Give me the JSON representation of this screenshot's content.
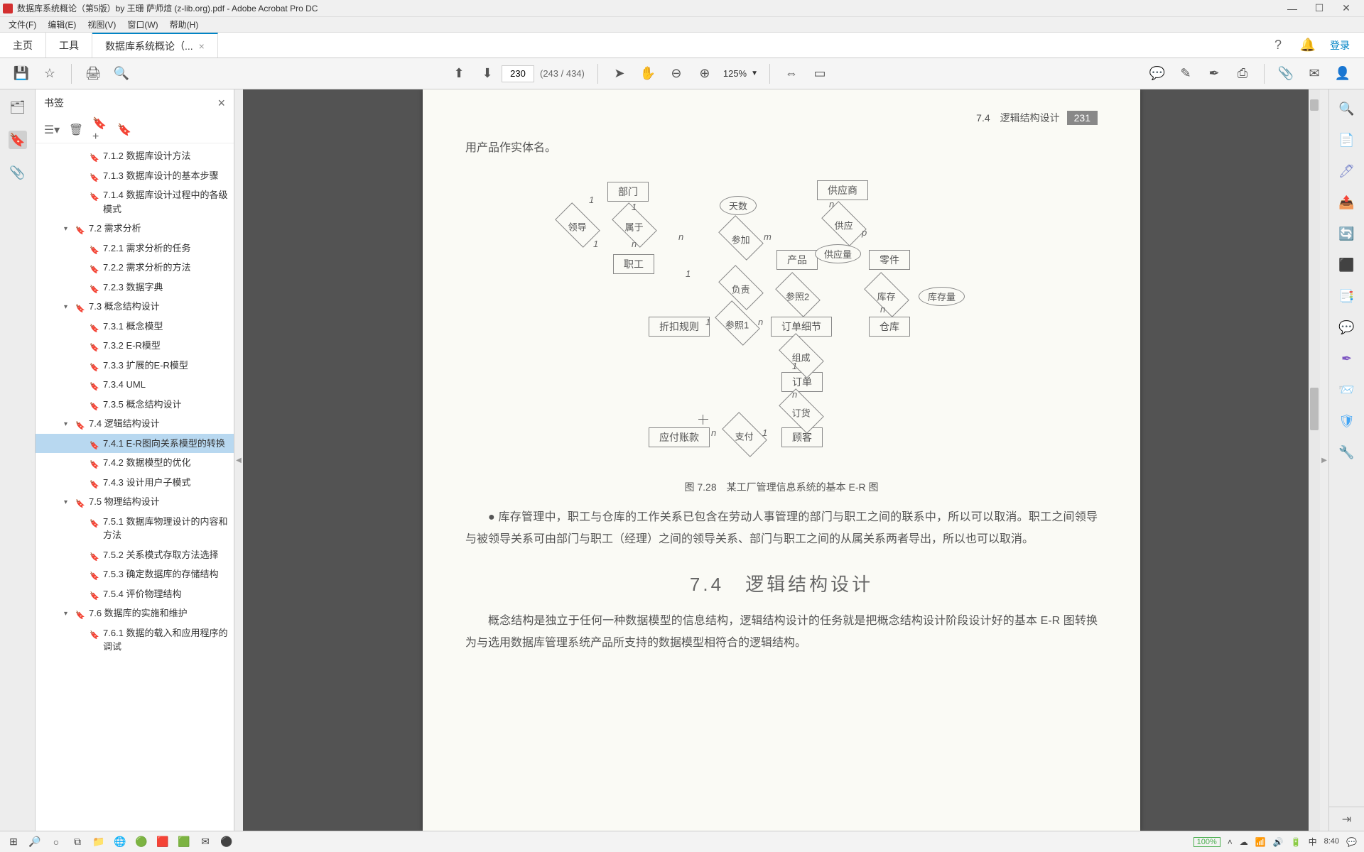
{
  "titlebar": {
    "title": "数据库系统概论（第5版）by 王珊 萨师煊 (z-lib.org).pdf - Adobe Acrobat Pro DC"
  },
  "menubar": {
    "items": [
      "文件(F)",
      "编辑(E)",
      "视图(V)",
      "窗口(W)",
      "帮助(H)"
    ]
  },
  "tabs": {
    "home": "主页",
    "tools": "工具",
    "doc": "数据库系统概论（..."
  },
  "tab_right": {
    "login": "登录"
  },
  "toolbar": {
    "page_value": "230",
    "page_total": "(243 / 434)",
    "zoom": "125%"
  },
  "bookmarks": {
    "title": "书签",
    "items": [
      {
        "lvl": 3,
        "label": "7.1.2 数据库设计方法",
        "toggle": ""
      },
      {
        "lvl": 3,
        "label": "7.1.3 数据库设计的基本步骤",
        "toggle": ""
      },
      {
        "lvl": 3,
        "label": "7.1.4 数据库设计过程中的各级模式",
        "toggle": ""
      },
      {
        "lvl": 2,
        "label": "7.2 需求分析",
        "toggle": "▾"
      },
      {
        "lvl": 3,
        "label": "7.2.1 需求分析的任务",
        "toggle": ""
      },
      {
        "lvl": 3,
        "label": "7.2.2 需求分析的方法",
        "toggle": ""
      },
      {
        "lvl": 3,
        "label": "7.2.3 数据字典",
        "toggle": ""
      },
      {
        "lvl": 2,
        "label": "7.3 概念结构设计",
        "toggle": "▾"
      },
      {
        "lvl": 3,
        "label": "7.3.1 概念模型",
        "toggle": ""
      },
      {
        "lvl": 3,
        "label": "7.3.2 E-R模型",
        "toggle": ""
      },
      {
        "lvl": 3,
        "label": "7.3.3 扩展的E-R模型",
        "toggle": ""
      },
      {
        "lvl": 3,
        "label": "7.3.4 UML",
        "toggle": ""
      },
      {
        "lvl": 3,
        "label": "7.3.5 概念结构设计",
        "toggle": ""
      },
      {
        "lvl": 2,
        "label": "7.4 逻辑结构设计",
        "toggle": "▾"
      },
      {
        "lvl": 3,
        "label": "7.4.1 E-R图向关系模型的转换",
        "toggle": "",
        "selected": true
      },
      {
        "lvl": 3,
        "label": "7.4.2 数据模型的优化",
        "toggle": ""
      },
      {
        "lvl": 3,
        "label": "7.4.3 设计用户子模式",
        "toggle": ""
      },
      {
        "lvl": 2,
        "label": "7.5 物理结构设计",
        "toggle": "▾"
      },
      {
        "lvl": 3,
        "label": "7.5.1 数据库物理设计的内容和方法",
        "toggle": ""
      },
      {
        "lvl": 3,
        "label": "7.5.2 关系模式存取方法选择",
        "toggle": ""
      },
      {
        "lvl": 3,
        "label": "7.5.3 确定数据库的存储结构",
        "toggle": ""
      },
      {
        "lvl": 3,
        "label": "7.5.4 评价物理结构",
        "toggle": ""
      },
      {
        "lvl": 2,
        "label": "7.6 数据库的实施和维护",
        "toggle": "▾"
      },
      {
        "lvl": 3,
        "label": "7.6.1 数据的载入和应用程序的调试",
        "toggle": ""
      }
    ]
  },
  "page": {
    "header_section": "7.4　逻辑结构设计",
    "header_page": "231",
    "line1": "用产品作实体名。",
    "caption": "图 7.28　某工厂管理信息系统的基本 E-R 图",
    "bullet": "● 库存管理中，职工与仓库的工作关系已包含在劳动人事管理的部门与职工之间的联系中，所以可以取消。职工之间领导与被领导关系可由部门与职工（经理）之间的领导关系、部门与职工之间的从属关系两者导出，所以也可以取消。",
    "section_title": "7.4　逻辑结构设计",
    "para1": "概念结构是独立于任何一种数据模型的信息结构，逻辑结构设计的任务就是把概念结构设计阶段设计好的基本 E-R 图转换为与选用数据库管理系统产品所支持的数据模型相符合的逻辑结构。",
    "er": {
      "e_dept": "部门",
      "e_emp": "职工",
      "e_sup": "供应商",
      "e_part": "零件",
      "e_prod": "产品",
      "e_wh": "仓库",
      "e_detail": "订单细节",
      "e_order": "订单",
      "e_cust": "顾客",
      "e_disc": "折扣规则",
      "e_ap": "应付账款",
      "d_lead": "领导",
      "d_belong": "属于",
      "d_join": "参加",
      "d_supply": "供应",
      "d_charge": "负责",
      "d_ref2": "参照2",
      "d_stock": "库存",
      "d_ref1": "参照1",
      "d_comp": "组成",
      "d_book": "订货",
      "d_pay": "支付",
      "o_days": "天数",
      "o_qty": "供应量",
      "o_stkq": "库存量"
    }
  },
  "tray": {
    "zoom": "100%",
    "time": "8:40"
  }
}
